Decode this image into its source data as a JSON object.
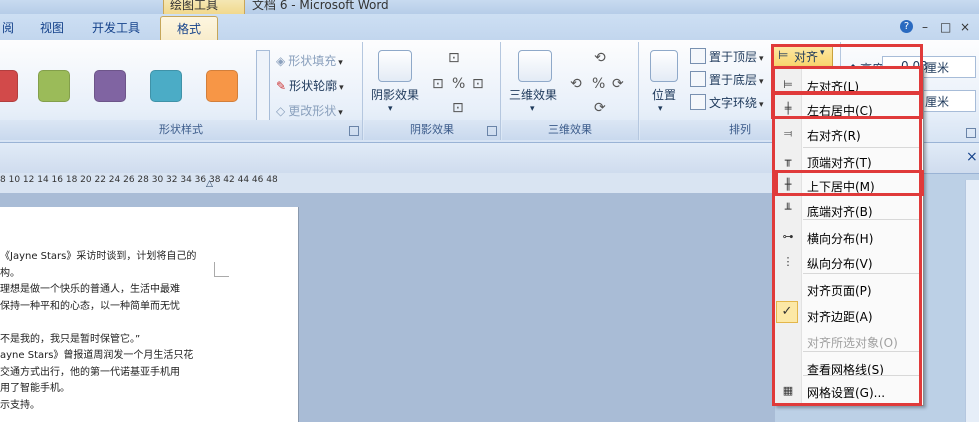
{
  "titlebar": {
    "context_tab": "绘图工具",
    "doc_title": "文档 6 - Microsoft Word"
  },
  "tabs": {
    "view_partial": "阅",
    "view": "视图",
    "developer": "开发工具",
    "format": "格式"
  },
  "window": {
    "help": "?",
    "minimize": "–",
    "restore": "□",
    "close": "×"
  },
  "ribbon": {
    "shape_styles": {
      "label": "形状样式",
      "fill": "形状填充",
      "outline": "形状轮廓",
      "change": "更改形状",
      "swatches": [
        "#d24a4a",
        "#9bbb59",
        "#8064a2",
        "#4bacc6",
        "#f79646"
      ]
    },
    "shadow": {
      "label": "阴影效果",
      "button": "阴影效果"
    },
    "threed": {
      "label": "三维效果",
      "button": "三维效果"
    },
    "arrange": {
      "label": "排列",
      "position": "位置",
      "bring_front": "置于顶层",
      "send_back": "置于底层",
      "text_wrap": "文字环绕",
      "align": "对齐"
    },
    "size": {
      "height_label": "高度",
      "height_value": "0.03",
      "unit": "厘米"
    }
  },
  "ruler": {
    "ticks": "8  10  12  14  16  18  20  22  24  26  28  30  32  34  36  38     42  44  46  48"
  },
  "document": {
    "lines": [
      "《Jayne Stars》采访时谈到，计划将自己的",
      "构。",
      "理想是做一个快乐的普通人，生活中最难",
      "保持一种平和的心态，以一种简单而无忧",
      "",
      "不是我的，我只是暂时保管它。”",
      "ayne Stars》曾报道周润发一个月生活只花",
      "交通方式出行，他的第一代诺基亚手机用",
      "用了智能手机。",
      "示支持。"
    ]
  },
  "menu": {
    "items": [
      {
        "icon": "⊨",
        "label": "左对齐(L)",
        "disabled": false
      },
      {
        "icon": "╪",
        "label": "左右居中(C)",
        "disabled": false
      },
      {
        "icon": "⫤",
        "label": "右对齐(R)",
        "disabled": false
      },
      {
        "icon": "╥",
        "label": "顶端对齐(T)",
        "disabled": false
      },
      {
        "icon": "╫",
        "label": "上下居中(M)",
        "disabled": false
      },
      {
        "icon": "╨",
        "label": "底端对齐(B)",
        "disabled": false
      },
      {
        "icon": "⊶",
        "label": "横向分布(H)",
        "disabled": false
      },
      {
        "icon": "⋮",
        "label": "纵向分布(V)",
        "disabled": false
      },
      {
        "icon": "",
        "label": "对齐页面(P)",
        "disabled": false
      },
      {
        "icon": "✓",
        "label": "对齐边距(A)",
        "disabled": false
      },
      {
        "icon": "",
        "label": "对齐所选对象(O)",
        "disabled": true
      },
      {
        "icon": "",
        "label": "查看网格线(S)",
        "disabled": false
      },
      {
        "icon": "▦",
        "label": "网格设置(G)...",
        "disabled": false
      }
    ]
  },
  "highlight_color": "#e03a3a"
}
